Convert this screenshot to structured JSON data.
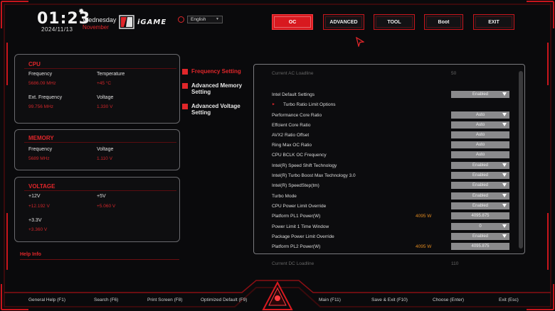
{
  "header": {
    "time": "01:23",
    "weekday": "Wednesday",
    "month": "November",
    "date": "2024/11/13",
    "brand": "iGAME",
    "language": "English"
  },
  "nav": [
    "OC",
    "ADVANCED",
    "TOOL",
    "Boot",
    "EXIT"
  ],
  "cpu": {
    "title": "CPU",
    "frequency_label": "Frequency",
    "frequency": "5686.09 MHz",
    "temperature_label": "Temperature",
    "temperature": "+45 °C",
    "ext_frequency_label": "Ext. Frequency",
    "ext_frequency": "99.756 MHz",
    "voltage_label": "Voltage",
    "voltage": "1.330 V"
  },
  "memory": {
    "title": "MEMORY",
    "frequency_label": "Frequency",
    "frequency": "5689 MHz",
    "voltage_label": "Voltage",
    "voltage": "1.110 V"
  },
  "voltage": {
    "title": "VOLTAGE",
    "v12_label": "+12V",
    "v12": "+12.192 V",
    "v5_label": "+5V",
    "v5": "+5.060 V",
    "v33_label": "+3.3V",
    "v33": "+3.360 V"
  },
  "help_label": "Help Info",
  "menu": [
    "Frequency Setting",
    "Advanced Memory Setting",
    "Advanced Voltage Setting"
  ],
  "settings": [
    {
      "name": "Current AC Loadline",
      "value": "50",
      "dim": true
    },
    {
      "name": "Intel Default Settings",
      "value": "Enabled",
      "dropdown": true
    },
    {
      "name": "Turbo Ratio Limit Options",
      "submenu": true
    },
    {
      "name": "Performance Core Ratio",
      "value": "Auto",
      "dropdown": true
    },
    {
      "name": "Effcient Core Ratio",
      "value": "Auto",
      "dropdown": true
    },
    {
      "name": "AVX2 Ratio Offset",
      "value": "Auto"
    },
    {
      "name": "Ring Max OC Ratio",
      "value": "Auto"
    },
    {
      "name": "CPU BCLK OC Frequency",
      "value": "Auto"
    },
    {
      "name": "Intel(R) Speed Shift Technology",
      "value": "Enabled",
      "dropdown": true
    },
    {
      "name": "Intel(R) Turbo Boost Max Technology 3.0",
      "value": "Enabled",
      "dropdown": true
    },
    {
      "name": "Intel(R) SpeedStep(tm)",
      "value": "Enabled",
      "dropdown": true
    },
    {
      "name": "Turbo Mode",
      "value": "Enabled",
      "dropdown": true
    },
    {
      "name": "CPU Power Limit Override",
      "value": "Enabled",
      "dropdown": true
    },
    {
      "name": "Platform PL1 Power(W)",
      "current": "4095 W",
      "value": "4095.875"
    },
    {
      "name": "Power Limit 1 Time Window",
      "value": "0",
      "dropdown": true
    },
    {
      "name": "Package Power Limit Override",
      "value": "Enabled",
      "dropdown": true
    },
    {
      "name": "Platform PL2 Power(W)",
      "current": "4095 W",
      "value": "4095.875"
    },
    {
      "name": "Current DC Loadline",
      "value": "110",
      "dim": true
    }
  ],
  "footer": [
    "General Help (F1)",
    "Search (F6)",
    "Print Screen (F8)",
    "Optimized Default (F9)",
    "Main (F11)",
    "Save & Exit (F10)",
    "Choose (Enter)",
    "Exit (Esc)"
  ],
  "colors": {
    "accent": "#e0262a",
    "background": "#0a0a0c",
    "orange": "#e08a20"
  }
}
